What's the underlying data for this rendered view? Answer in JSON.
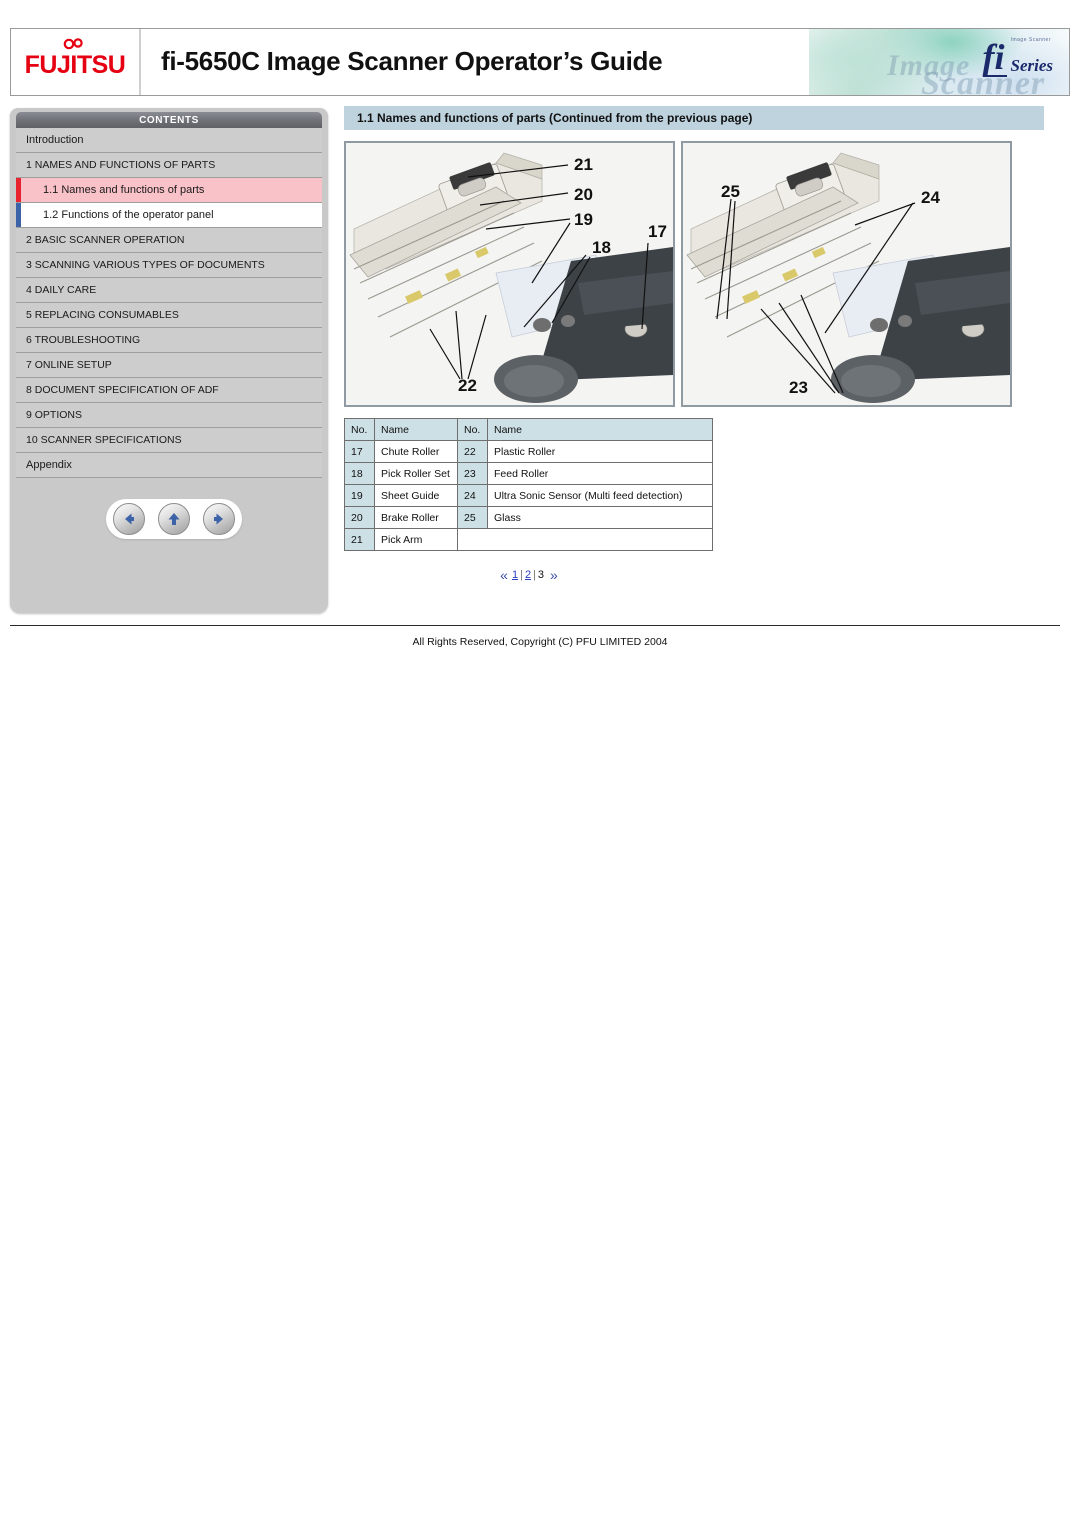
{
  "header": {
    "brand": "FUJITSU",
    "title": "fi-5650C Image Scanner Operator’s Guide",
    "banner": {
      "fi": "fi",
      "series": "Series",
      "tagline": "Image Scanner",
      "watermark_image": "Image",
      "watermark_scanner": "Scanner"
    }
  },
  "sidebar": {
    "header_label": "CONTENTS",
    "items": [
      {
        "label": "Introduction",
        "type": "plain"
      },
      {
        "label": "1 NAMES AND FUNCTIONS OF PARTS",
        "type": "level0"
      },
      {
        "label": "1.1 Names and functions of parts",
        "type": "sub",
        "active": true
      },
      {
        "label": "1.2 Functions of the operator panel",
        "type": "sub",
        "active": false
      },
      {
        "label": "2 BASIC SCANNER OPERATION",
        "type": "level0"
      },
      {
        "label": "3 SCANNING VARIOUS TYPES OF DOCUMENTS",
        "type": "level0"
      },
      {
        "label": "4 DAILY CARE",
        "type": "level0"
      },
      {
        "label": "5 REPLACING CONSUMABLES",
        "type": "level0"
      },
      {
        "label": "6 TROUBLESHOOTING",
        "type": "level0"
      },
      {
        "label": "7 ONLINE SETUP",
        "type": "level0"
      },
      {
        "label": "8 DOCUMENT SPECIFICATION OF ADF",
        "type": "level0"
      },
      {
        "label": "9 OPTIONS",
        "type": "level0"
      },
      {
        "label": "10 SCANNER SPECIFICATIONS",
        "type": "level0"
      },
      {
        "label": "Appendix",
        "type": "plain"
      }
    ],
    "nav_buttons": [
      {
        "name": "back-arrow-icon",
        "glyph": "←"
      },
      {
        "name": "up-arrow-icon",
        "glyph": "↑"
      },
      {
        "name": "forward-arrow-icon",
        "glyph": "→"
      }
    ]
  },
  "main": {
    "page_title": "1.1 Names and functions of parts (Continued from the previous page)",
    "figures": [
      {
        "alt": "scanner-adf-open-left",
        "callouts": [
          "21",
          "20",
          "19",
          "18",
          "17",
          "22"
        ]
      },
      {
        "alt": "scanner-adf-open-right",
        "callouts": [
          "25",
          "24",
          "23"
        ]
      }
    ],
    "table": {
      "headers": [
        "No.",
        "Name",
        "No.",
        "Name"
      ],
      "rows": [
        {
          "no1": "17",
          "name1": "Chute Roller",
          "no2": "22",
          "name2": "Plastic Roller"
        },
        {
          "no1": "18",
          "name1": "Pick Roller Set",
          "no2": "23",
          "name2": "Feed Roller"
        },
        {
          "no1": "19",
          "name1": "Sheet Guide",
          "no2": "24",
          "name2": "Ultra Sonic Sensor (Multi feed detection)"
        },
        {
          "no1": "20",
          "name1": "Brake Roller",
          "no2": "25",
          "name2": "Glass"
        },
        {
          "no1": "21",
          "name1": "Pick Arm",
          "no2": "",
          "name2": ""
        }
      ]
    },
    "pagination": {
      "first": "«",
      "last": "»",
      "pages": [
        {
          "label": "1",
          "current": false
        },
        {
          "label": "2",
          "current": false
        },
        {
          "label": "3",
          "current": true
        }
      ],
      "separator": "|"
    }
  },
  "footer": {
    "copyright": "All Rights Reserved, Copyright (C) PFU LIMITED 2004"
  },
  "colors": {
    "brand_red": "#e50012",
    "title_bar": "#bed3de",
    "active_item": "#f9c2c8",
    "active_bar": "#e8232f",
    "sub_bar": "#3c62a8",
    "table_header": "#cde0e6",
    "link": "#2b3fbd"
  }
}
